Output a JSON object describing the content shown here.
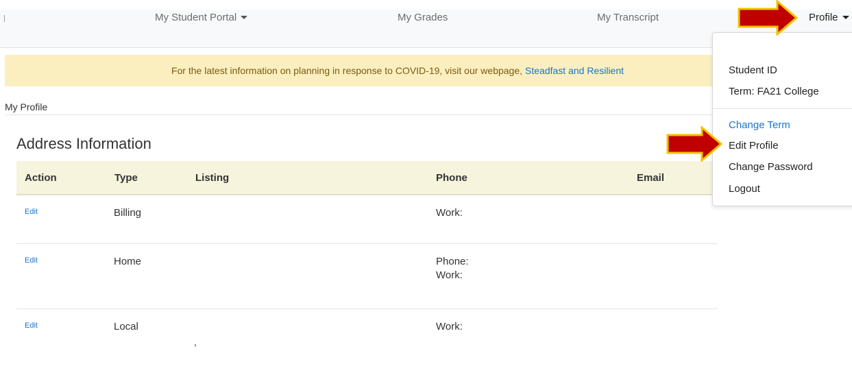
{
  "nav": {
    "portal_label": "My Student Portal",
    "grades_label": "My Grades",
    "transcript_label": "My Transcript",
    "profile_label": "Profile"
  },
  "banner": {
    "text": "For the latest information on planning in response to COVID-19, visit our webpage,",
    "link_text": "Steadfast and Resilient"
  },
  "page": {
    "label": "My Profile",
    "section_title": "Address Information"
  },
  "table": {
    "headers": [
      "Action",
      "Type",
      "Listing",
      "Phone",
      "Email"
    ],
    "rows": [
      {
        "action": "Edit",
        "type": "Billing",
        "listing": "",
        "phone": [
          "Work:"
        ],
        "email": ""
      },
      {
        "action": "Edit",
        "type": "Home",
        "listing": "",
        "phone": [
          "Phone:",
          "Work:"
        ],
        "email": ""
      },
      {
        "action": "Edit",
        "type": "Local",
        "listing": ",",
        "phone": [
          "Work:"
        ],
        "email": ""
      }
    ]
  },
  "profile_menu": {
    "student_id": "Student ID",
    "term": "Term: FA21 College",
    "change_term": "Change Term",
    "edit_profile": "Edit Profile",
    "change_password": "Change Password",
    "logout": "Logout"
  },
  "colors": {
    "banner_bg": "#fcefbf",
    "link": "#1a73c9",
    "table_header_bg": "#f6f4dc",
    "arrow_fill": "#c00000",
    "arrow_outline": "#f2c200"
  }
}
